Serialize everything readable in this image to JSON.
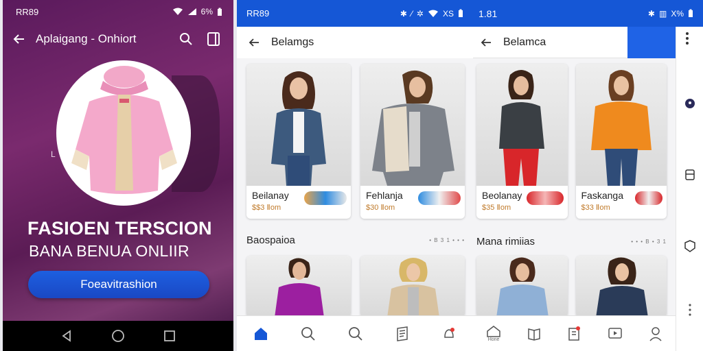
{
  "screen1": {
    "status_time": "RR89",
    "status_battery": "6%",
    "appbar_title": "Aplaigang - Onhiort",
    "headline": "FASIOEN TERSCION",
    "subline": "BANA BENUA ONLIIR",
    "cta_label": "Foeavitrashion",
    "marker": "L"
  },
  "screen2": {
    "status_time": "RR89",
    "status_right": "XS",
    "appbar_title": "Belamgs",
    "products": [
      {
        "name": "Beilanay",
        "price": "$$3 Ⅱom"
      },
      {
        "name": "Fehlanja",
        "price": "$30 Ⅱom"
      }
    ],
    "section_title": "Baospaioa",
    "section_more": "• B 3 1 • • •",
    "accent": "#1557d6"
  },
  "screen3": {
    "status_time": "1.81",
    "status_right": "X%",
    "appbar_title": "Belamca",
    "products": [
      {
        "name": "Beolanay",
        "price": "$35 Ⅱom"
      },
      {
        "name": "Faskanga",
        "price": "$33 Ⅱom"
      }
    ],
    "section_title": "Mana rimiias",
    "section_more": "• • • B • 3 1",
    "nav_label_1": "Hone"
  }
}
